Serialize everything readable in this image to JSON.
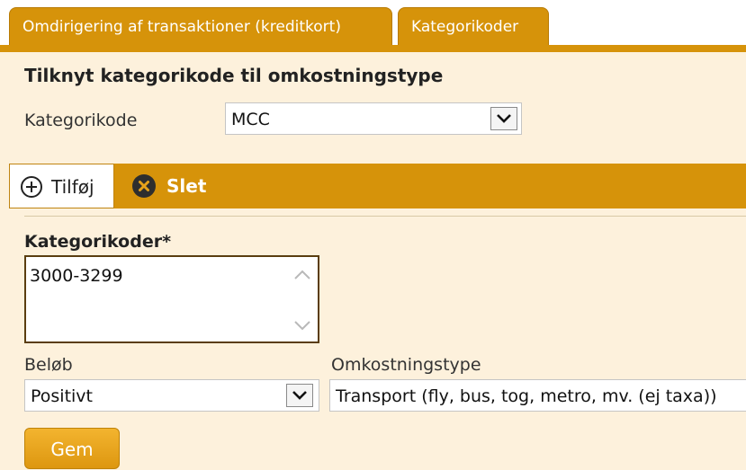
{
  "tabs": [
    {
      "label": "Omdirigering af transaktioner (kreditkort)"
    },
    {
      "label": "Kategorikoder"
    }
  ],
  "section": {
    "title": "Tilknyt kategorikode til omkostningstype"
  },
  "kategorikode": {
    "label": "Kategorikode",
    "selected": "MCC"
  },
  "toolbar": {
    "add_label": "Tilføj",
    "delete_label": "Slet"
  },
  "form": {
    "codes_label": "Kategorikoder*",
    "codes_value": "3000-3299",
    "belob_label": "Beløb",
    "belob_value": "Positivt",
    "omk_label": "Omkostningstype",
    "omk_value": "Transport (fly, bus, tog, metro, mv. (ej taxa))",
    "save_label": "Gem"
  },
  "colors": {
    "accent": "#d6930a",
    "panel": "#fdf1dc"
  }
}
